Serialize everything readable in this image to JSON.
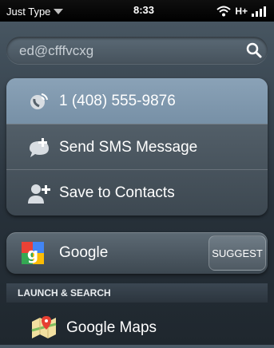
{
  "status_bar": {
    "app_menu": "Just Type",
    "time": "8:33",
    "network": "H+"
  },
  "search": {
    "query": "ed@cfffvcxg",
    "icon": "search-icon"
  },
  "actions": [
    {
      "label": "1 (408) 555-9876",
      "icon": "phone-icon"
    },
    {
      "label": "Send SMS Message",
      "icon": "sms-icon"
    },
    {
      "label": "Save to Contacts",
      "icon": "add-contact-icon"
    }
  ],
  "search_engine": {
    "label": "Google",
    "icon": "google-icon",
    "suggest_label": "SUGGEST"
  },
  "launch_section": {
    "title": "LAUNCH & SEARCH",
    "items": [
      {
        "label": "Google Maps",
        "icon": "google-maps-icon"
      }
    ]
  },
  "colors": {
    "highlight": "#8aa2b7",
    "background": "#27313a"
  }
}
